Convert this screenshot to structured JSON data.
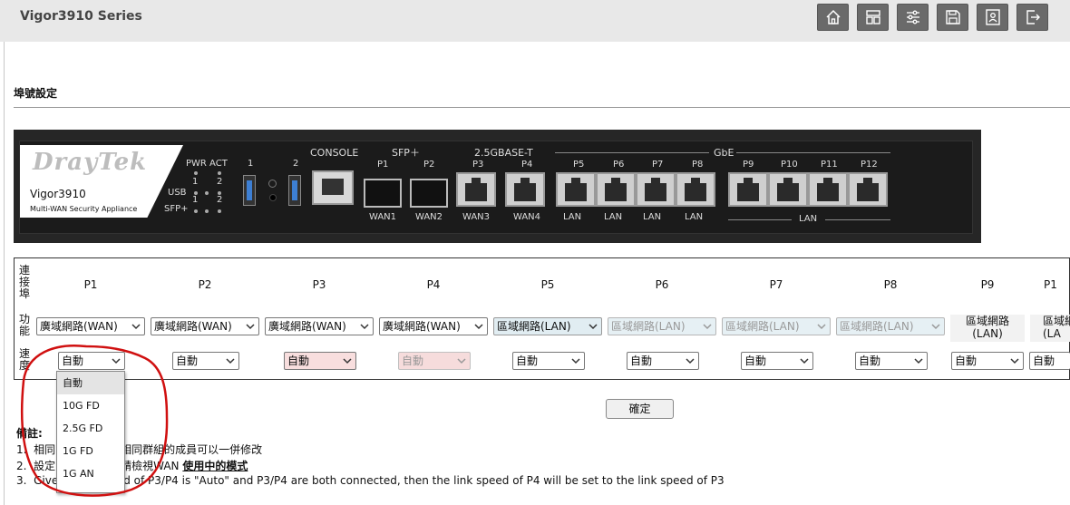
{
  "header": {
    "title": "Vigor3910 Series",
    "icons": [
      "home-icon",
      "dashboard-icon",
      "settings-icon",
      "save-icon",
      "contact-icon",
      "logout-icon"
    ]
  },
  "section": {
    "title": "埠號設定"
  },
  "device": {
    "logo": "DrayTek",
    "model": "Vigor3910",
    "subtitle": "Multi-WAN Security Appliance",
    "pwr_act": "PWR ACT",
    "usb_label": "USB",
    "sfp_label": "SFP+",
    "led_1": "1",
    "led_2": "2",
    "usb_port_1": "1",
    "usb_port_2": "2",
    "console": "CONSOLE",
    "sfp_group": "SFP＋",
    "base_t_group": "2.5GBASE-T",
    "gbe_group": "GbE",
    "ports": [
      "P1",
      "P2",
      "P3",
      "P4",
      "P5",
      "P6",
      "P7",
      "P8",
      "P9",
      "P10",
      "P11",
      "P12"
    ],
    "port_roles": [
      "WAN1",
      "WAN2",
      "WAN3",
      "WAN4",
      "LAN",
      "LAN",
      "LAN",
      "LAN"
    ],
    "lan_group": "LAN"
  },
  "table": {
    "row_port": "連接埠",
    "row_function": "功能",
    "row_speed": "速度",
    "ports": [
      "P1",
      "P2",
      "P3",
      "P4",
      "P5",
      "P6",
      "P7",
      "P8",
      "P9",
      "P1"
    ],
    "functions": [
      "廣域網路(WAN)",
      "廣域網路(WAN)",
      "廣域網路(WAN)",
      "廣域網路(WAN)",
      "區域網路(LAN)",
      "區域網路(LAN)",
      "區域網路(LAN)",
      "區域網路(LAN)"
    ],
    "static_function": "區域網路\n(LAN)",
    "static_function_line1": "區域網路",
    "static_function_line2": "(LAN)",
    "static_function_cut_line1": "區域網",
    "static_function_cut_line2": "(LA",
    "speeds": [
      "自動",
      "自動",
      "自動",
      "自動",
      "自動",
      "自動",
      "自動",
      "自動",
      "自動",
      "自動"
    ]
  },
  "confirm": "確定",
  "notes": {
    "title": "備註:",
    "line1_num": "1.",
    "line1a": "相同",
    "line1b": "相同群組的成員可以一併修改",
    "line2_num": "2.",
    "line2a": "設定",
    "line2b": "請檢視WAN",
    "line2_bold": "使用中的模式",
    "line3_num": "3.",
    "line3a": "Give",
    "line3b": "d of P3/P4 is \"Auto\" and P3/P4 are both connected, then the link speed of P4 will be set to the link speed of P3"
  },
  "dropdown": {
    "options": [
      "自動",
      "10G FD",
      "2.5G FD",
      "1G FD",
      "1G AN"
    ],
    "highlighted": 0
  }
}
